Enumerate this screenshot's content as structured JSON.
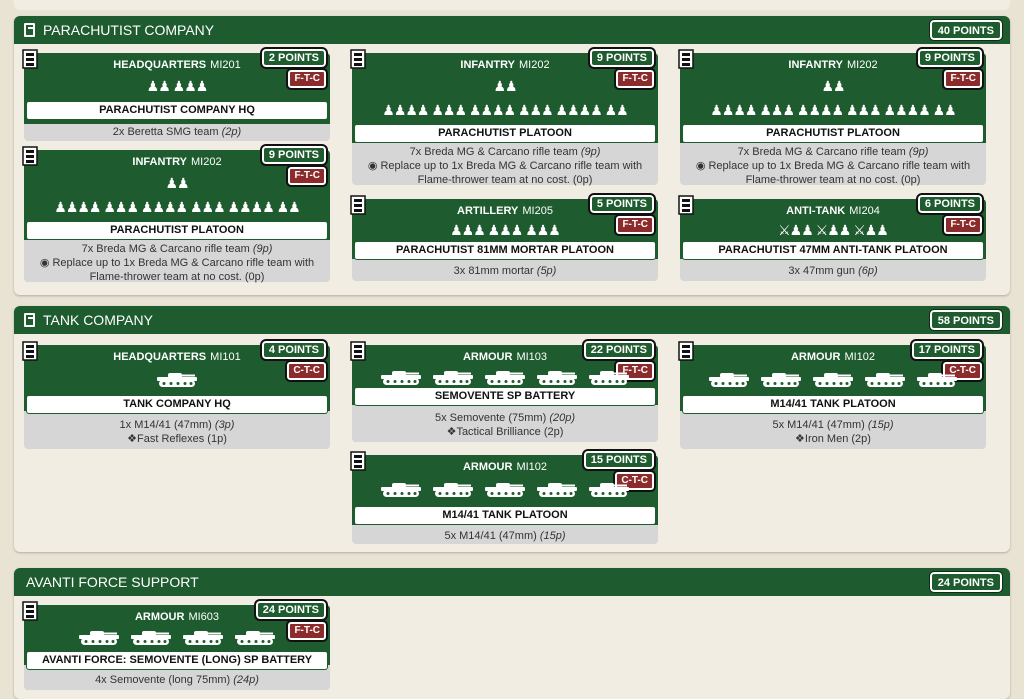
{
  "top_fragment": "",
  "sections": [
    {
      "id": "parachutist",
      "title": "PARACHUTIST COMPANY",
      "points": "40 POINTS",
      "cards": [
        {
          "type": "HEADQUARTERS",
          "code": "MI201",
          "points": "2 POINTS",
          "motivation": "F-T-C",
          "figures": "♟♟ ♟♟♟",
          "name": "PARACHUTIST COMPANY HQ",
          "lines": [
            {
              "text": "2x Beretta SMG team",
              "cost": "(2p)"
            }
          ]
        },
        {
          "type": "INFANTRY",
          "code": "MI202",
          "points": "9 POINTS",
          "motivation": "F-T-C",
          "figures": "♟♟",
          "figures2": "♟♟♟♟ ♟♟♟ ♟♟♟♟ ♟♟♟ ♟♟♟♟ ♟♟",
          "name": "PARACHUTIST PLATOON",
          "lines": [
            {
              "text": "7x Breda MG & Carcano rifle team",
              "cost": "(9p)"
            },
            {
              "text": "◉ Replace up to 1x Breda MG & Carcano rifle team with Flame-thrower team at no cost. (0p)",
              "cost": ""
            }
          ]
        },
        {
          "type": "INFANTRY",
          "code": "MI202",
          "points": "9 POINTS",
          "motivation": "F-T-C",
          "figures": "♟♟",
          "figures2": "♟♟♟♟ ♟♟♟ ♟♟♟♟ ♟♟♟ ♟♟♟♟ ♟♟",
          "name": "PARACHUTIST PLATOON",
          "lines": [
            {
              "text": "7x Breda MG & Carcano rifle team",
              "cost": "(9p)"
            },
            {
              "text": "◉ Replace up to 1x Breda MG & Carcano rifle team with Flame-thrower team at no cost. (0p)",
              "cost": ""
            }
          ]
        },
        {
          "type": "INFANTRY",
          "code": "MI202",
          "points": "9 POINTS",
          "motivation": "F-T-C",
          "figures": "♟♟",
          "figures2": "♟♟♟♟ ♟♟♟ ♟♟♟♟ ♟♟♟ ♟♟♟♟ ♟♟",
          "name": "PARACHUTIST PLATOON",
          "lines": [
            {
              "text": "7x Breda MG & Carcano rifle team",
              "cost": "(9p)"
            },
            {
              "text": "◉ Replace up to 1x Breda MG & Carcano rifle team with Flame-thrower team at no cost. (0p)",
              "cost": ""
            }
          ]
        },
        {
          "type": "ARTILLERY",
          "code": "MI205",
          "points": "5 POINTS",
          "motivation": "F-T-C",
          "figures": "♟♟♟ ♟♟♟ ♟♟♟",
          "name": "PARACHUTIST 81MM MORTAR PLATOON",
          "lines": [
            {
              "text": "3x 81mm mortar",
              "cost": "(5p)"
            }
          ]
        },
        {
          "type": "ANTI-TANK",
          "code": "MI204",
          "points": "6 POINTS",
          "motivation": "F-T-C",
          "figures": "⚔♟♟ ⚔♟♟ ⚔♟♟",
          "name": "PARACHUTIST 47MM ANTI-TANK PLATOON",
          "lines": [
            {
              "text": "3x 47mm gun",
              "cost": "(6p)"
            }
          ]
        }
      ]
    },
    {
      "id": "tank",
      "title": "TANK COMPANY",
      "points": "58 POINTS",
      "cards": [
        {
          "type": "HEADQUARTERS",
          "code": "MI101",
          "points": "4 POINTS",
          "motivation": "C-T-C",
          "tanks": 1,
          "name": "TANK COMPANY HQ",
          "lines": [
            {
              "text": "1x M14/41 (47mm)",
              "cost": "(3p)"
            },
            {
              "text": "Fast Reflexes (1p)",
              "cost": "",
              "icon": true
            }
          ]
        },
        {
          "type": "ARMOUR",
          "code": "MI103",
          "points": "22 POINTS",
          "motivation": "F-T-C",
          "tanks": 5,
          "name": "SEMOVENTE SP BATTERY",
          "lines": [
            {
              "text": "5x Semovente (75mm)",
              "cost": "(20p)"
            },
            {
              "text": "Tactical Brilliance (2p)",
              "cost": "",
              "icon": true
            }
          ]
        },
        {
          "type": "ARMOUR",
          "code": "MI102",
          "points": "17 POINTS",
          "motivation": "C-T-C",
          "tanks": 5,
          "name": "M14/41 TANK PLATOON",
          "lines": [
            {
              "text": "5x M14/41 (47mm)",
              "cost": "(15p)"
            },
            {
              "text": "Iron Men (2p)",
              "cost": "",
              "icon": true
            }
          ]
        },
        {
          "type": "ARMOUR",
          "code": "MI102",
          "points": "15 POINTS",
          "motivation": "C-T-C",
          "tanks": 5,
          "name": "M14/41 TANK PLATOON",
          "lines": [
            {
              "text": "5x M14/41 (47mm)",
              "cost": "(15p)"
            }
          ]
        }
      ]
    },
    {
      "id": "avanti",
      "title": "AVANTI FORCE SUPPORT",
      "points": "24 POINTS",
      "cards": [
        {
          "type": "ARMOUR",
          "code": "MI603",
          "points": "24 POINTS",
          "motivation": "F-T-C",
          "tanks": 4,
          "name": "AVANTI FORCE: SEMOVENTE (LONG) SP BATTERY",
          "lines": [
            {
              "text": "4x Semovente (long 75mm)",
              "cost": "(24p)"
            }
          ]
        }
      ]
    }
  ]
}
